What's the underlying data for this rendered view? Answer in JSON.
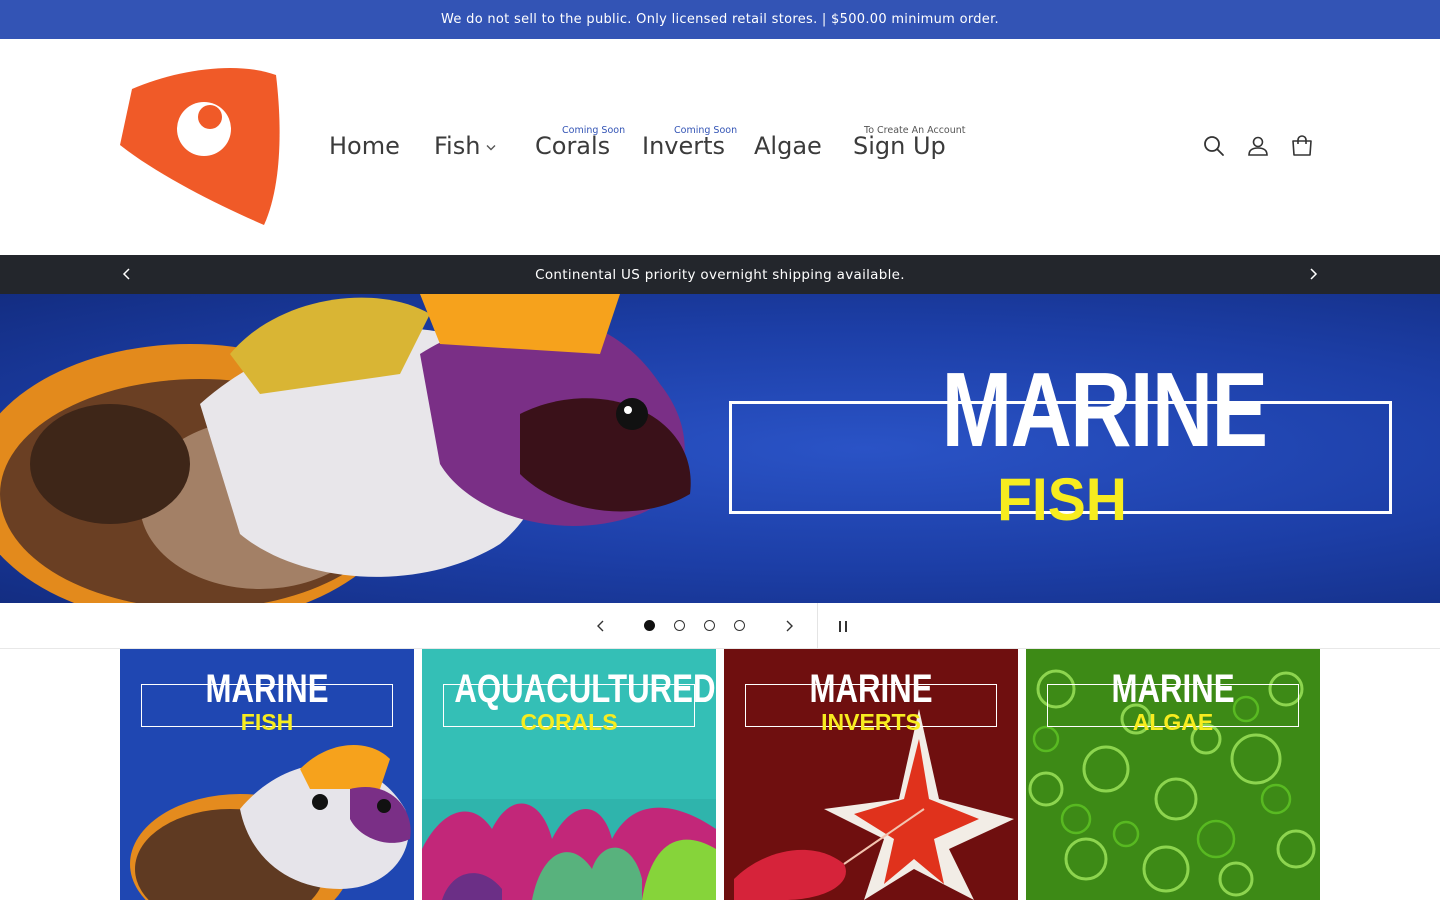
{
  "announcement": "We do not sell to the public. Only licensed retail stores. | $500.00 minimum order.",
  "brand": {
    "accent": "#3354b5",
    "logo_color": "#f05a28"
  },
  "nav": {
    "home": "Home",
    "fish": "Fish",
    "corals": "Corals",
    "corals_note": "Coming Soon",
    "inverts": "Inverts",
    "inverts_note": "Coming Soon",
    "algae": "Algae",
    "signup": "Sign Up",
    "signup_note": "To Create An Account"
  },
  "header_icons": [
    "search-icon",
    "account-icon",
    "cart-icon"
  ],
  "shipping": "Continental US priority overnight shipping available.",
  "hero": {
    "title": "MARINE",
    "subtitle": "FISH"
  },
  "slider": {
    "slides": 4,
    "active": 1
  },
  "tiles": [
    {
      "title": "MARINE",
      "subtitle": "FISH"
    },
    {
      "title": "AQUACULTURED",
      "subtitle": "CORALS"
    },
    {
      "title": "MARINE",
      "subtitle": "INVERTS"
    },
    {
      "title": "MARINE",
      "subtitle": "ALGAE"
    }
  ]
}
